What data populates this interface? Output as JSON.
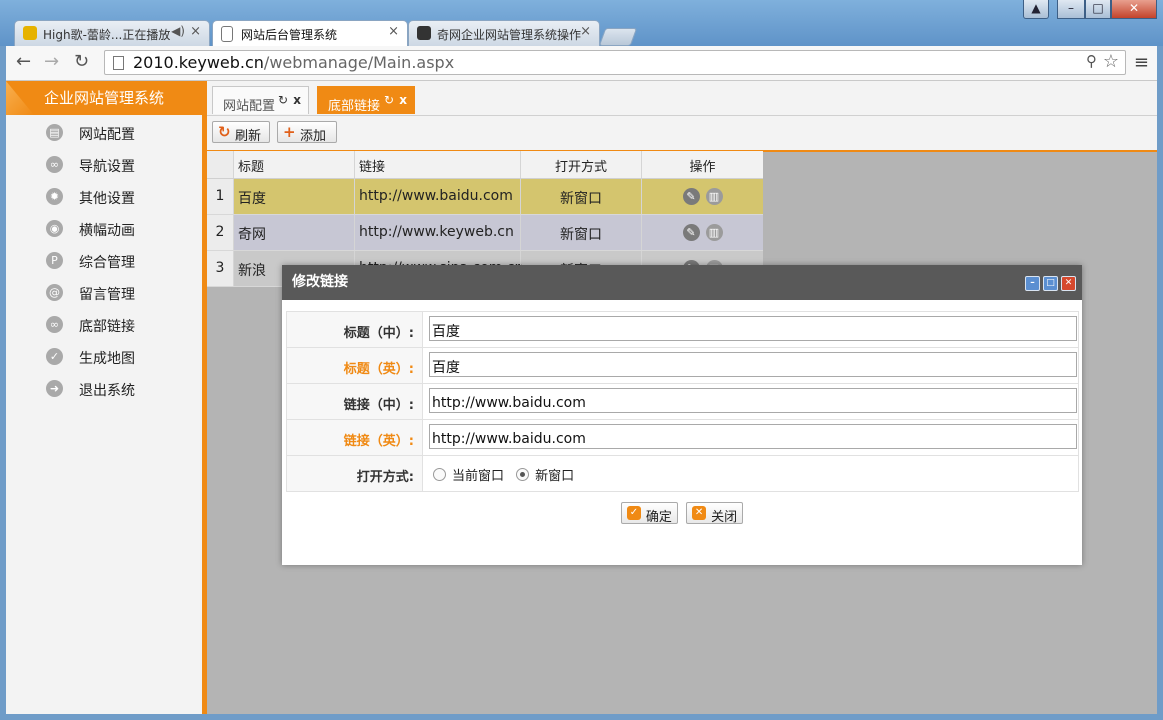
{
  "browser": {
    "tabs": [
      {
        "label": "High歌-蕾龄...正在播放",
        "active": false
      },
      {
        "label": "网站后台管理系统",
        "active": true
      },
      {
        "label": "奇网企业网站管理系统操作",
        "active": false
      }
    ],
    "url_host": "2010.keyweb.cn",
    "url_path": "/webmanage/Main.aspx"
  },
  "sidebar": {
    "brand": "企业网站管理系统",
    "items": [
      {
        "label": "网站配置",
        "icon": "config-icon"
      },
      {
        "label": "导航设置",
        "icon": "link-icon"
      },
      {
        "label": "其他设置",
        "icon": "gear-icon"
      },
      {
        "label": "横幅动画",
        "icon": "camera-icon"
      },
      {
        "label": "综合管理",
        "icon": "p-icon"
      },
      {
        "label": "留言管理",
        "icon": "at-icon"
      },
      {
        "label": "底部链接",
        "icon": "link-icon"
      },
      {
        "label": "生成地图",
        "icon": "check-icon"
      },
      {
        "label": "退出系统",
        "icon": "exit-icon"
      }
    ]
  },
  "content_tabs": [
    {
      "label": "网站配置",
      "active": false
    },
    {
      "label": "底部链接",
      "active": true
    }
  ],
  "toolbar": {
    "refresh_label": "刷新",
    "add_label": "添加"
  },
  "grid": {
    "headers": [
      "标题",
      "链接",
      "打开方式",
      "操作"
    ],
    "rows": [
      {
        "num": "1",
        "title": "百度",
        "link": "http://www.baidu.com",
        "open": "新窗口"
      },
      {
        "num": "2",
        "title": "奇网",
        "link": "http://www.keyweb.cn",
        "open": "新窗口"
      },
      {
        "num": "3",
        "title": "新浪",
        "link": "http://www.sina.com.cn",
        "open": "新窗口"
      }
    ]
  },
  "modal": {
    "title": "修改链接",
    "fields": {
      "title_cn_label": "标题（中）:",
      "title_cn_value": "百度",
      "title_en_label": "标题（英）:",
      "title_en_value": "百度",
      "link_cn_label": "链接（中）:",
      "link_cn_value": "http://www.baidu.com",
      "link_en_label": "链接（英）:",
      "link_en_value": "http://www.baidu.com",
      "open_label": "打开方式:",
      "open_options": [
        "当前窗口",
        "新窗口"
      ],
      "open_selected": "新窗口"
    },
    "ok_label": "确定",
    "close_label": "关闭"
  },
  "colors": {
    "accent": "#f08a14",
    "selected_row": "#d4c56e",
    "modal_header": "#595959"
  }
}
